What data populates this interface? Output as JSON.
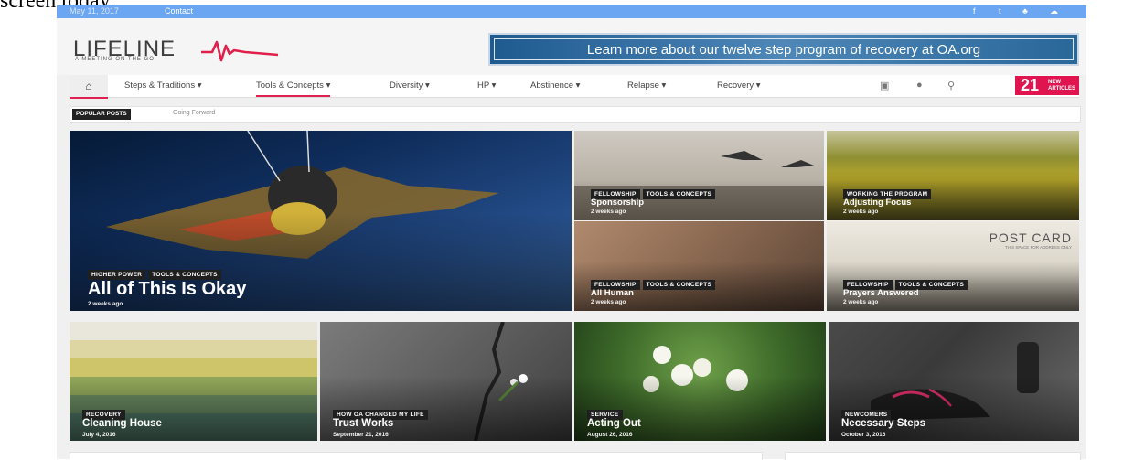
{
  "caption": "screen today:",
  "topbar": {
    "date": "May 11, 2017",
    "contact": "Contact",
    "social": [
      "f",
      "t",
      "♣",
      "☁"
    ]
  },
  "logo": {
    "name": "LIFELINE",
    "tagline": "A MEETING ON THE GO"
  },
  "banner": {
    "text": "Learn more about our twelve step program of recovery at OA.org"
  },
  "nav": {
    "home_icon": "home-icon",
    "items": [
      "Steps & Traditions ▾",
      "Tools & Concepts ▾",
      "Diversity ▾",
      "HP ▾",
      "Abstinence ▾",
      "Relapse ▾",
      "Recovery ▾"
    ],
    "active_index": 1,
    "new_count": "21",
    "new_label_1": "NEW",
    "new_label_2": "ARTICLES"
  },
  "ticker": {
    "label": "POPULAR POSTS",
    "text": "Going Forward"
  },
  "colors": {
    "accent": "#e0154f",
    "topbar": "#6aa6f2"
  },
  "featured": [
    {
      "cats": [
        "HIGHER POWER",
        "TOOLS & CONCEPTS"
      ],
      "title": "All of This Is Okay",
      "date": "2 weeks ago"
    },
    {
      "cats": [
        "FELLOWSHIP",
        "TOOLS & CONCEPTS"
      ],
      "title": "Sponsorship",
      "date": "2 weeks ago"
    },
    {
      "cats": [
        "WORKING THE PROGRAM"
      ],
      "title": "Adjusting Focus",
      "date": "2 weeks ago"
    },
    {
      "cats": [
        "FELLOWSHIP",
        "TOOLS & CONCEPTS"
      ],
      "title": "All Human",
      "date": "2 weeks ago"
    },
    {
      "cats": [
        "FELLOWSHIP",
        "TOOLS & CONCEPTS"
      ],
      "title": "Prayers Answered",
      "date": "2 weeks ago",
      "postcard_title": "POST CARD",
      "postcard_sub": "THIS SPACE FOR ADDRESS ONLY"
    }
  ],
  "row": [
    {
      "cat": "RECOVERY",
      "title": "Cleaning House",
      "date": "July 4, 2016"
    },
    {
      "cat": "HOW OA CHANGED MY LIFE",
      "title": "Trust Works",
      "date": "September 21, 2016"
    },
    {
      "cat": "SERVICE",
      "title": "Acting Out",
      "date": "August 26, 2016"
    },
    {
      "cat": "NEWCOMERS",
      "title": "Necessary Steps",
      "date": "October 3, 2016"
    }
  ]
}
